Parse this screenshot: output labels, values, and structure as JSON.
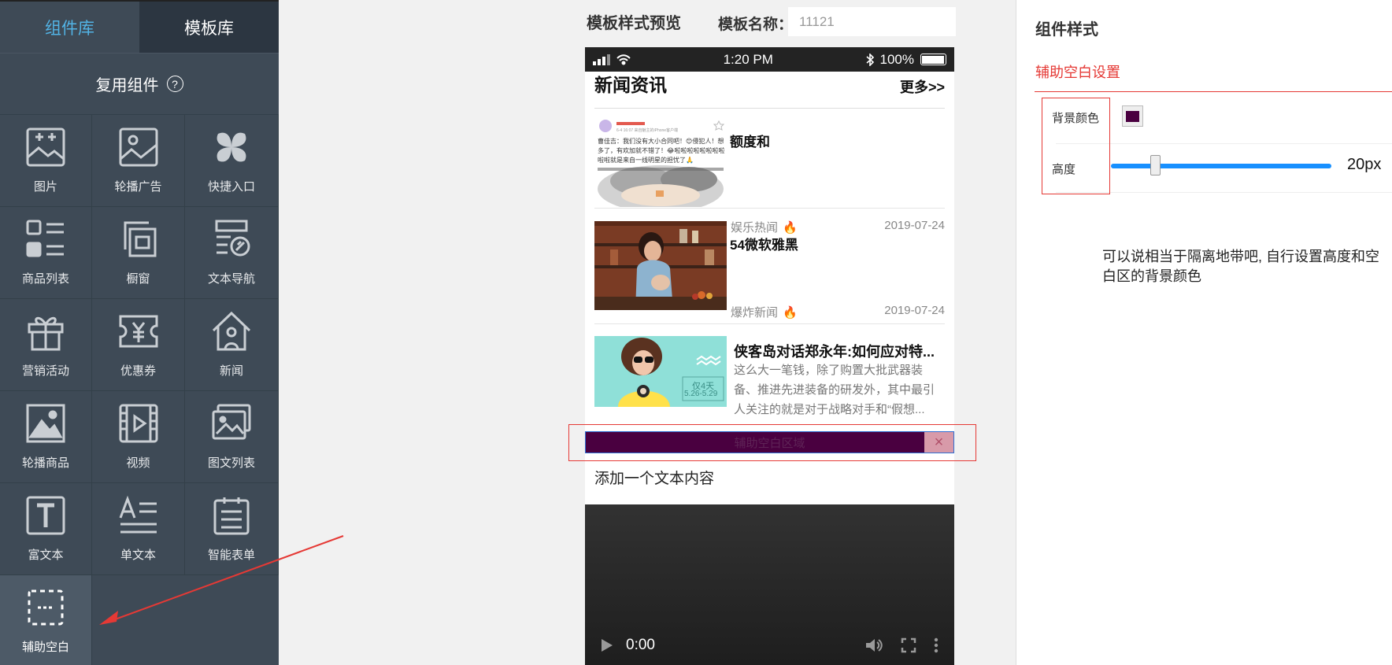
{
  "sidebar": {
    "tabs": [
      {
        "label": "组件库",
        "active": true
      },
      {
        "label": "模板库",
        "active": false
      }
    ],
    "section_title": "复用组件",
    "help_symbol": "?",
    "components": [
      {
        "label": "图片",
        "icon": "image-add-icon"
      },
      {
        "label": "轮播广告",
        "icon": "carousel-ad-icon"
      },
      {
        "label": "快捷入口",
        "icon": "shortcut-entry-icon"
      },
      {
        "label": "商品列表",
        "icon": "product-list-icon"
      },
      {
        "label": "橱窗",
        "icon": "showcase-icon"
      },
      {
        "label": "文本导航",
        "icon": "text-nav-icon"
      },
      {
        "label": "营销活动",
        "icon": "gift-icon"
      },
      {
        "label": "优惠券",
        "icon": "coupon-icon"
      },
      {
        "label": "新闻",
        "icon": "house-icon"
      },
      {
        "label": "轮播商品",
        "icon": "carousel-product-icon"
      },
      {
        "label": "视频",
        "icon": "video-icon"
      },
      {
        "label": "图文列表",
        "icon": "image-text-list-icon"
      },
      {
        "label": "富文本",
        "icon": "rich-text-icon"
      },
      {
        "label": "单文本",
        "icon": "single-text-icon"
      },
      {
        "label": "智能表单",
        "icon": "smart-form-icon"
      },
      {
        "label": "辅助空白",
        "icon": "blank-space-icon",
        "active": true
      }
    ]
  },
  "preview": {
    "title": "模板样式预览",
    "template_name_label": "模板名称：",
    "template_name_value": "11121"
  },
  "phone": {
    "status": {
      "time": "1:20 PM",
      "battery": "100%"
    },
    "news_header": {
      "title": "新闻资讯",
      "more": "更多>>"
    },
    "news": [
      {
        "title": "额度和",
        "category": "娱乐热闻",
        "date": "2019-07-24"
      },
      {
        "title": "54微软雅黑",
        "category": "爆炸新闻",
        "date": "2019-07-24"
      },
      {
        "title": "侠客岛对话郑永年:如何应对特...",
        "summary": "这么大一笔钱，除了购置大批武器装备、推进先进装备的研发外，其中最引人关注的就是对于战略对手和“假想..."
      }
    ],
    "thumb1_text": {
      "line1": "曹佳吉：我们没有大小合同吧！😊侵犯人！想多了，有欢加就不错了！😂啦啦啦啦啦啦啦啦啦啦就是来自一线明星的担忧了🙏",
      "meta": "6-4 16:07  来自魅主的iPhone客户端"
    },
    "thumb3_text": {
      "line1": "仅4天",
      "line2": "5.26-5.29"
    },
    "spacer_label": "辅助空白区域",
    "spacer_close": "×",
    "text_block": "添加一个文本内容",
    "video_time": "0:00"
  },
  "panel": {
    "title": "组件样式",
    "subtitle": "辅助空白设置",
    "bg_color_label": "背景颜色",
    "bg_color": "#4a0040",
    "height_label": "高度",
    "height_value": "20px",
    "slider_fraction": 0.2,
    "note": "可以说相当于隔离地带吧, 自行设置高度和空白区的背景颜色"
  }
}
